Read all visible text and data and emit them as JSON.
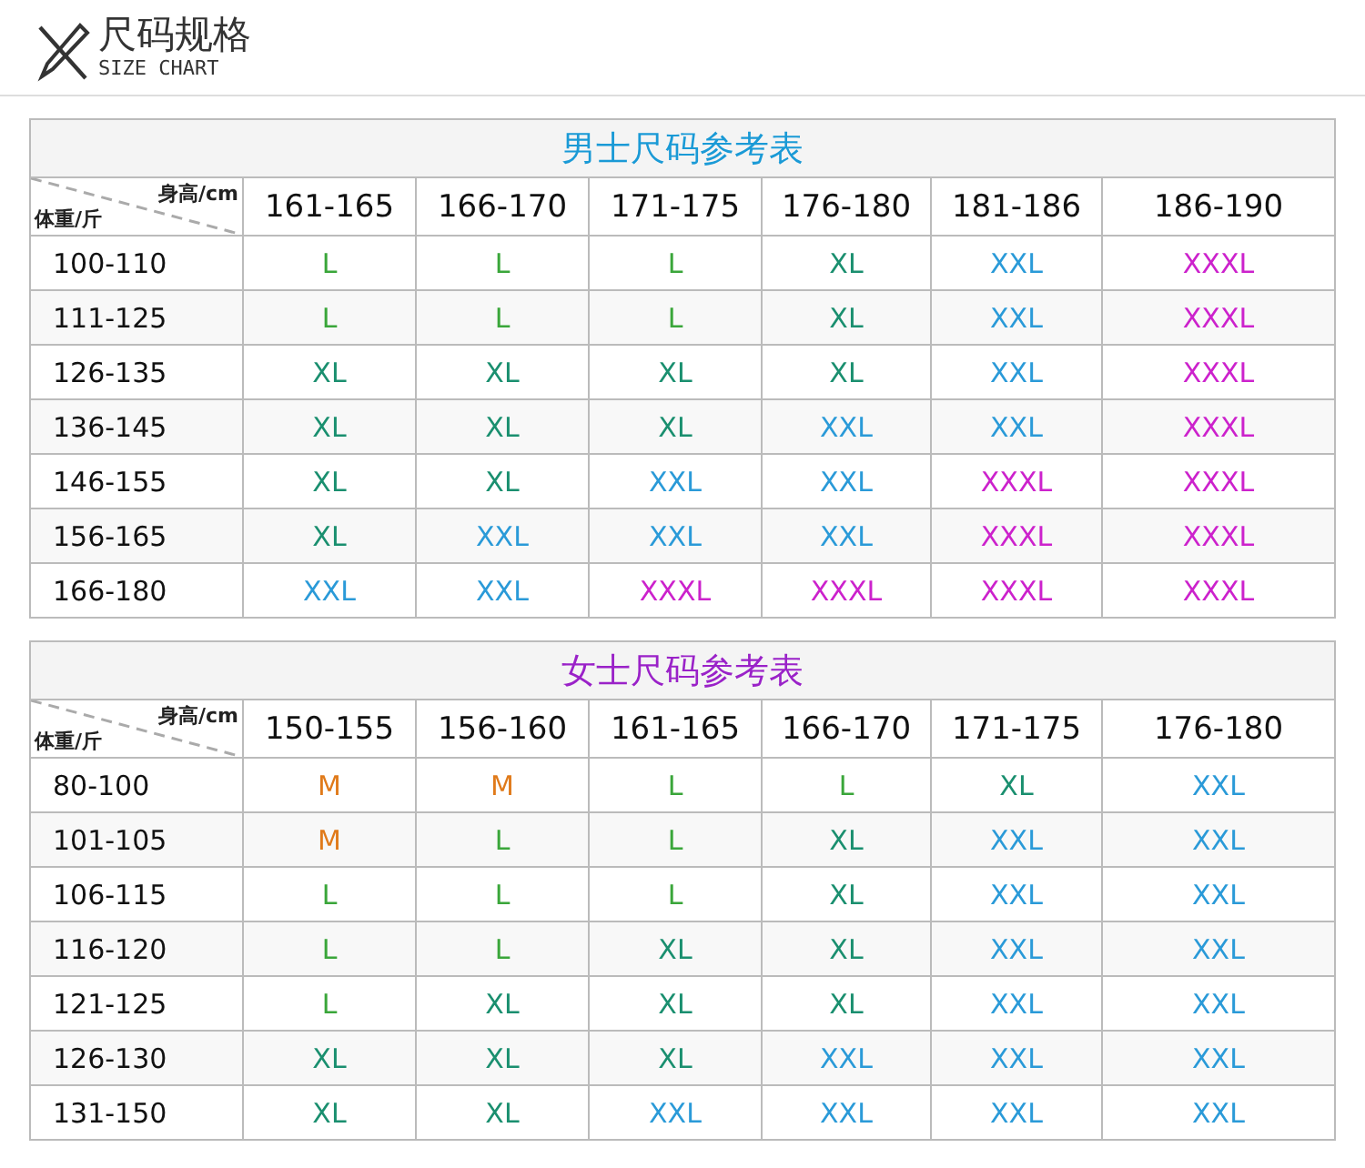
{
  "header": {
    "title": "尺码规格",
    "subtitle": "SIZE CHART"
  },
  "tables": [
    {
      "title": "男士尺码参考表",
      "color": "#1a9ad6",
      "corner": {
        "top": "身高/cm",
        "bottom": "体重/斤"
      },
      "columns": [
        "161-165",
        "166-170",
        "171-175",
        "176-180",
        "181-186",
        "186-190"
      ],
      "rows": [
        {
          "label": "100-110",
          "cells": [
            {
              "text": "L",
              "color": "#3aa63a"
            },
            {
              "text": "L",
              "color": "#3aa63a"
            },
            {
              "text": "L",
              "color": "#3aa63a"
            },
            {
              "text": "XL",
              "color": "#1a8f6f"
            },
            {
              "text": "XXL",
              "color": "#2a9ad8"
            },
            {
              "text": "XXXL",
              "color": "#cc22cc"
            }
          ]
        },
        {
          "label": "111-125",
          "cells": [
            {
              "text": "L",
              "color": "#3aa63a"
            },
            {
              "text": "L",
              "color": "#3aa63a"
            },
            {
              "text": "L",
              "color": "#3aa63a"
            },
            {
              "text": "XL",
              "color": "#1a8f6f"
            },
            {
              "text": "XXL",
              "color": "#2a9ad8"
            },
            {
              "text": "XXXL",
              "color": "#cc22cc"
            }
          ]
        },
        {
          "label": "126-135",
          "cells": [
            {
              "text": "XL",
              "color": "#1a8f6f"
            },
            {
              "text": "XL",
              "color": "#1a8f6f"
            },
            {
              "text": "XL",
              "color": "#1a8f6f"
            },
            {
              "text": "XL",
              "color": "#1a8f6f"
            },
            {
              "text": "XXL",
              "color": "#2a9ad8"
            },
            {
              "text": "XXXL",
              "color": "#cc22cc"
            }
          ]
        },
        {
          "label": "136-145",
          "cells": [
            {
              "text": "XL",
              "color": "#1a8f6f"
            },
            {
              "text": "XL",
              "color": "#1a8f6f"
            },
            {
              "text": "XL",
              "color": "#1a8f6f"
            },
            {
              "text": "XXL",
              "color": "#2a9ad8"
            },
            {
              "text": "XXL",
              "color": "#2a9ad8"
            },
            {
              "text": "XXXL",
              "color": "#cc22cc"
            }
          ]
        },
        {
          "label": "146-155",
          "cells": [
            {
              "text": "XL",
              "color": "#1a8f6f"
            },
            {
              "text": "XL",
              "color": "#1a8f6f"
            },
            {
              "text": "XXL",
              "color": "#2a9ad8"
            },
            {
              "text": "XXL",
              "color": "#2a9ad8"
            },
            {
              "text": "XXXL",
              "color": "#cc22cc"
            },
            {
              "text": "XXXL",
              "color": "#cc22cc"
            }
          ]
        },
        {
          "label": "156-165",
          "cells": [
            {
              "text": "XL",
              "color": "#1a8f6f"
            },
            {
              "text": "XXL",
              "color": "#2a9ad8"
            },
            {
              "text": "XXL",
              "color": "#2a9ad8"
            },
            {
              "text": "XXL",
              "color": "#2a9ad8"
            },
            {
              "text": "XXXL",
              "color": "#cc22cc"
            },
            {
              "text": "XXXL",
              "color": "#cc22cc"
            }
          ]
        },
        {
          "label": "166-180",
          "cells": [
            {
              "text": "XXL",
              "color": "#2a9ad8"
            },
            {
              "text": "XXL",
              "color": "#2a9ad8"
            },
            {
              "text": "XXXL",
              "color": "#cc22cc"
            },
            {
              "text": "XXXL",
              "color": "#cc22cc"
            },
            {
              "text": "XXXL",
              "color": "#cc22cc"
            },
            {
              "text": "XXXL",
              "color": "#cc22cc"
            }
          ]
        }
      ]
    },
    {
      "title": "女士尺码参考表",
      "color": "#9a22c8",
      "corner": {
        "top": "身高/cm",
        "bottom": "体重/斤"
      },
      "columns": [
        "150-155",
        "156-160",
        "161-165",
        "166-170",
        "171-175",
        "176-180"
      ],
      "rows": [
        {
          "label": "80-100",
          "cells": [
            {
              "text": "M",
              "color": "#e07a1a"
            },
            {
              "text": "M",
              "color": "#e07a1a"
            },
            {
              "text": "L",
              "color": "#3aa63a"
            },
            {
              "text": "L",
              "color": "#3aa63a"
            },
            {
              "text": "XL",
              "color": "#1a8f6f"
            },
            {
              "text": "XXL",
              "color": "#2a9ad8"
            }
          ]
        },
        {
          "label": "101-105",
          "cells": [
            {
              "text": "M",
              "color": "#e07a1a"
            },
            {
              "text": "L",
              "color": "#3aa63a"
            },
            {
              "text": "L",
              "color": "#3aa63a"
            },
            {
              "text": "XL",
              "color": "#1a8f6f"
            },
            {
              "text": "XXL",
              "color": "#2a9ad8"
            },
            {
              "text": "XXL",
              "color": "#2a9ad8"
            }
          ]
        },
        {
          "label": "106-115",
          "cells": [
            {
              "text": "L",
              "color": "#3aa63a"
            },
            {
              "text": "L",
              "color": "#3aa63a"
            },
            {
              "text": "L",
              "color": "#3aa63a"
            },
            {
              "text": "XL",
              "color": "#1a8f6f"
            },
            {
              "text": "XXL",
              "color": "#2a9ad8"
            },
            {
              "text": "XXL",
              "color": "#2a9ad8"
            }
          ]
        },
        {
          "label": "116-120",
          "cells": [
            {
              "text": "L",
              "color": "#3aa63a"
            },
            {
              "text": "L",
              "color": "#3aa63a"
            },
            {
              "text": "XL",
              "color": "#1a8f6f"
            },
            {
              "text": "XL",
              "color": "#1a8f6f"
            },
            {
              "text": "XXL",
              "color": "#2a9ad8"
            },
            {
              "text": "XXL",
              "color": "#2a9ad8"
            }
          ]
        },
        {
          "label": "121-125",
          "cells": [
            {
              "text": "L",
              "color": "#3aa63a"
            },
            {
              "text": "XL",
              "color": "#1a8f6f"
            },
            {
              "text": "XL",
              "color": "#1a8f6f"
            },
            {
              "text": "XL",
              "color": "#1a8f6f"
            },
            {
              "text": "XXL",
              "color": "#2a9ad8"
            },
            {
              "text": "XXL",
              "color": "#2a9ad8"
            }
          ]
        },
        {
          "label": "126-130",
          "cells": [
            {
              "text": "XL",
              "color": "#1a8f6f"
            },
            {
              "text": "XL",
              "color": "#1a8f6f"
            },
            {
              "text": "XL",
              "color": "#1a8f6f"
            },
            {
              "text": "XXL",
              "color": "#2a9ad8"
            },
            {
              "text": "XXL",
              "color": "#2a9ad8"
            },
            {
              "text": "XXL",
              "color": "#2a9ad8"
            }
          ]
        },
        {
          "label": "131-150",
          "cells": [
            {
              "text": "XL",
              "color": "#1a8f6f"
            },
            {
              "text": "XL",
              "color": "#1a8f6f"
            },
            {
              "text": "XXL",
              "color": "#2a9ad8"
            },
            {
              "text": "XXL",
              "color": "#2a9ad8"
            },
            {
              "text": "XXL",
              "color": "#2a9ad8"
            },
            {
              "text": "XXL",
              "color": "#2a9ad8"
            }
          ]
        }
      ]
    }
  ]
}
